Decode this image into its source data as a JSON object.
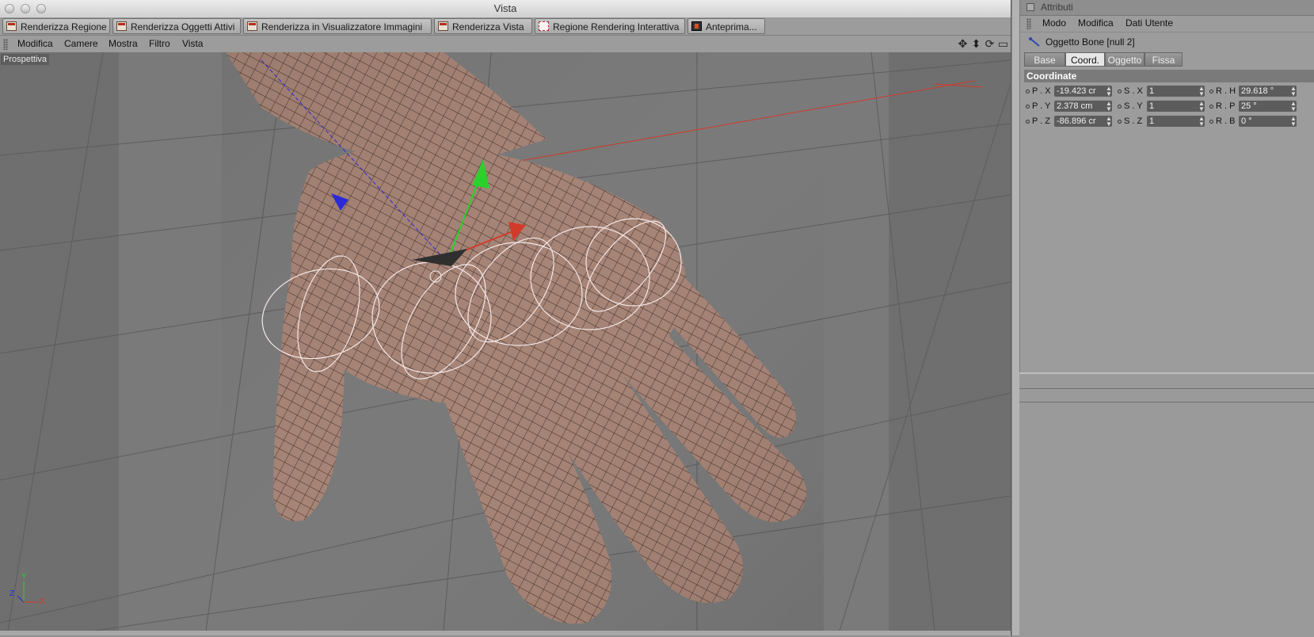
{
  "window": {
    "title": "Vista"
  },
  "render_toolbar": [
    {
      "label": "Renderizza Regione",
      "icon": "clapper-icon"
    },
    {
      "label": "Renderizza Oggetti Attivi",
      "icon": "clapper-icon"
    },
    {
      "label": "Renderizza in Visualizzatore Immagini",
      "icon": "clapper-icon"
    },
    {
      "label": "Renderizza Vista",
      "icon": "clapper-icon"
    },
    {
      "label": "Regione Rendering Interattiva",
      "icon": "region-icon"
    },
    {
      "label": "Anteprima...",
      "icon": "film-icon"
    }
  ],
  "view_menu": [
    "Modifica",
    "Camere",
    "Mostra",
    "Filtro",
    "Vista"
  ],
  "viewport": {
    "label": "Prospettiva",
    "axis_labels": {
      "x": "X",
      "y": "Y",
      "z": "Z"
    }
  },
  "attributes": {
    "title": "Attributi",
    "menu": [
      "Modo",
      "Modifica",
      "Dati Utente"
    ],
    "object_label": "Oggetto Bone [null 2]",
    "tabs": [
      {
        "label": "Base",
        "active": false
      },
      {
        "label": "Coord.",
        "active": true
      },
      {
        "label": "Oggetto",
        "active": false
      },
      {
        "label": "Fissa",
        "active": false
      }
    ],
    "section": "Coordinate",
    "rows": [
      [
        {
          "label": "P . X",
          "value": "-19.423 cr"
        },
        {
          "label": "S . X",
          "value": "1"
        },
        {
          "label": "R . H",
          "value": "29.618 °"
        }
      ],
      [
        {
          "label": "P . Y",
          "value": "2.378 cm"
        },
        {
          "label": "S . Y",
          "value": "1"
        },
        {
          "label": "R . P",
          "value": "25 °"
        }
      ],
      [
        {
          "label": "P . Z",
          "value": "-86.896 cr"
        },
        {
          "label": "S . Z",
          "value": "1"
        },
        {
          "label": "R . B",
          "value": "0 °"
        }
      ]
    ]
  },
  "colors": {
    "viewport_bg": "#6f6f6f",
    "skin": "#a68476",
    "wire": "#3a2a26",
    "x_axis": "#d23a2a",
    "y_axis": "#2bd12b",
    "z_axis": "#2a2ad8"
  }
}
